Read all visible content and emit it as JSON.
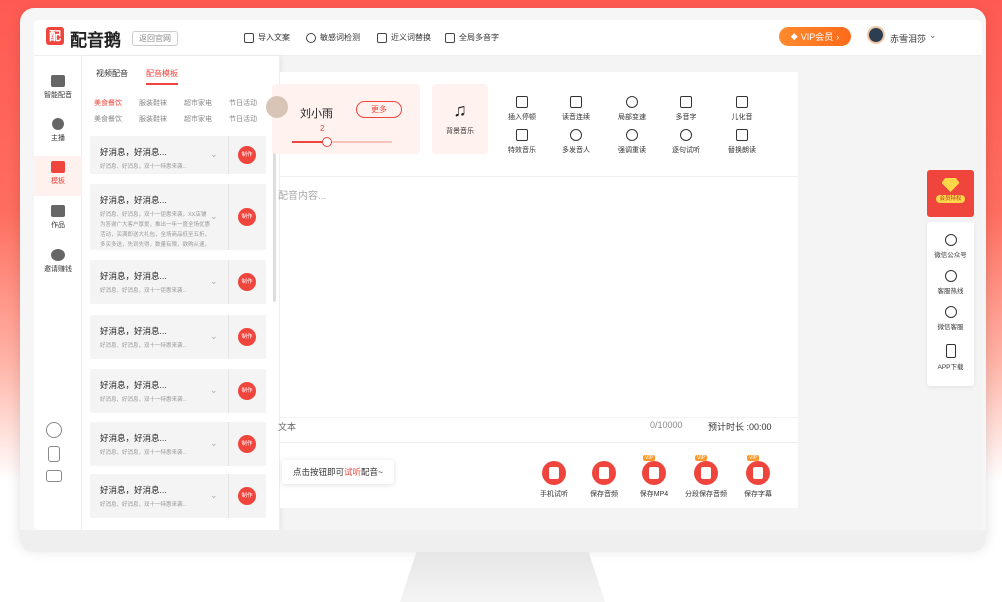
{
  "app": {
    "logo_char": "配",
    "name": "配音鹅",
    "back_link": "返回官网"
  },
  "toolbar": {
    "items": [
      {
        "label": "导入文案",
        "icon": "import-icon"
      },
      {
        "label": "敏感词检测",
        "icon": "sensitive-check-icon"
      },
      {
        "label": "近义词替换",
        "icon": "synonym-icon"
      },
      {
        "label": "全局多音字",
        "icon": "polyphone-icon"
      }
    ],
    "vip_label": "VIP会员",
    "username": "赤雪泪莎"
  },
  "leftnav": {
    "items": [
      {
        "label": "智能配音",
        "icon": "smart-dub-icon",
        "active": false
      },
      {
        "label": "主播",
        "icon": "anchor-icon",
        "active": false
      },
      {
        "label": "模板",
        "icon": "template-icon",
        "active": true
      },
      {
        "label": "作品",
        "icon": "folder-icon",
        "active": false
      },
      {
        "label": "邀请赚钱",
        "icon": "money-bag-icon",
        "active": false
      }
    ]
  },
  "panel": {
    "tabs": [
      {
        "label": "视频配音",
        "active": false
      },
      {
        "label": "配音模板",
        "active": true
      }
    ],
    "categories": [
      {
        "label": "美食餐饮",
        "active": true
      },
      {
        "label": "服装鞋袜",
        "active": false
      },
      {
        "label": "超市家电",
        "active": false
      },
      {
        "label": "节日活动",
        "active": false
      },
      {
        "label": "美食餐饮",
        "active": false
      },
      {
        "label": "服装鞋袜",
        "active": false
      },
      {
        "label": "超市家电",
        "active": false
      },
      {
        "label": "节日活动",
        "active": false
      }
    ],
    "make_label": "制作",
    "cards": [
      {
        "title": "好消息，好消息...",
        "desc": "好消息、好消息，双十一特惠来袭..."
      },
      {
        "title": "好消息，好消息...",
        "desc": "好消息、好消息，双十一钜惠来袭，XX店铺为答谢广大客户厚爱，推出一年一度全场优惠活动，买满即送大礼包，全场商品低至五折，多买多送，先到先得，数量有限，欲购从速，过时不候，心动不如行动，赶快来抢购吧。"
      },
      {
        "title": "好消息，好消息...",
        "desc": "好消息、好消息，双十一钜惠来袭..."
      },
      {
        "title": "好消息，好消息...",
        "desc": "好消息、好消息，双十一特惠来袭..."
      },
      {
        "title": "好消息，好消息...",
        "desc": "好消息、好消息，双十一特惠来袭..."
      },
      {
        "title": "好消息，好消息...",
        "desc": "好消息、好消息，双十一特惠来袭..."
      },
      {
        "title": "好消息，好消息...",
        "desc": "好消息、好消息，双十一特惠来袭..."
      }
    ]
  },
  "editor": {
    "voice_name": "刘小雨",
    "more_label": "更多",
    "speed_value": "2",
    "speed_fraction": 0.35,
    "bgm_label": "背景音乐",
    "features": [
      {
        "label": "插入停顿",
        "icon": "pause-insert-icon"
      },
      {
        "label": "读音连续",
        "icon": "continuous-read-icon"
      },
      {
        "label": "局部变速",
        "icon": "local-speed-icon"
      },
      {
        "label": "多音字",
        "icon": "polyphone-a-icon"
      },
      {
        "label": "儿化音",
        "icon": "er-sound-icon"
      },
      {
        "label": "特效音乐",
        "icon": "effect-music-icon"
      },
      {
        "label": "多发音人",
        "icon": "multi-speaker-icon"
      },
      {
        "label": "强调重读",
        "icon": "stress-icon"
      },
      {
        "label": "逐句试听",
        "icon": "sentence-listen-icon"
      },
      {
        "label": "替换朗读",
        "icon": "replace-read-icon"
      }
    ],
    "placeholder": "配音内容...",
    "text_label": "文本",
    "counter": "0/10000",
    "duration_label": "预计时长 :00:00"
  },
  "bottombar": {
    "hint_prefix": "点击按钮即可",
    "hint_highlight": "试听",
    "hint_suffix": "配音~",
    "actions": [
      {
        "label": "手机试听",
        "vip": false
      },
      {
        "label": "保存音频",
        "vip": false
      },
      {
        "label": "保存MP4",
        "vip": true
      },
      {
        "label": "分段保存音频",
        "vip": true
      },
      {
        "label": "保存字幕",
        "vip": true
      }
    ],
    "vip_tag": "VIP"
  },
  "right_float": {
    "vip_label": "会员特权",
    "items": [
      {
        "label": "微信公众号",
        "icon": "wechat-icon"
      },
      {
        "label": "客服热线",
        "icon": "phone-icon"
      },
      {
        "label": "微信客服",
        "icon": "customer-service-icon"
      },
      {
        "label": "APP下载",
        "icon": "mobile-icon"
      }
    ]
  },
  "colors": {
    "accent": "#f0453d",
    "vip_orange": "#ff7a1f",
    "gold": "#ffd84a"
  }
}
